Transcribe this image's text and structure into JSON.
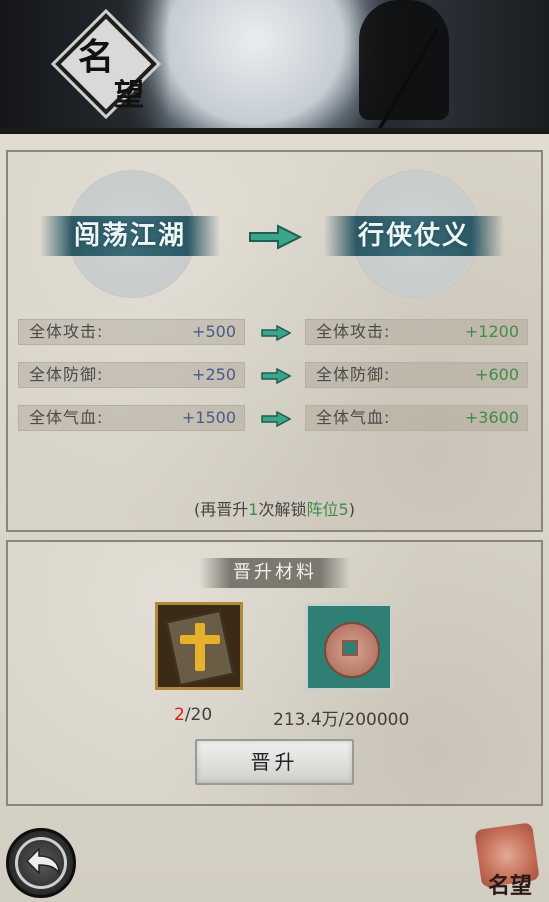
{
  "header": {
    "title_char1": "名",
    "title_char2": "望"
  },
  "rank": {
    "current": "闯荡江湖",
    "next": "行侠仗义"
  },
  "stats": [
    {
      "label": "全体攻击:",
      "current": "+500",
      "next": "+1200"
    },
    {
      "label": "全体防御:",
      "current": "+250",
      "next": "+600"
    },
    {
      "label": "全体气血:",
      "current": "+1500",
      "next": "+3600"
    }
  ],
  "unlock": {
    "prefix": "(再晋升",
    "times": "1",
    "middle": "次解锁",
    "target": "阵位5",
    "suffix": ")"
  },
  "materials": {
    "title": "晋升材料",
    "items": [
      {
        "name": "book-item",
        "have": "2",
        "need": "/20"
      },
      {
        "name": "coin-item",
        "text": "213.4万/200000"
      }
    ]
  },
  "promote_button": "晋升",
  "corner_label": "名望",
  "colors": {
    "increase": "#3f8c4a",
    "current_value": "#4a5a8a",
    "insufficient": "#d2231e"
  }
}
